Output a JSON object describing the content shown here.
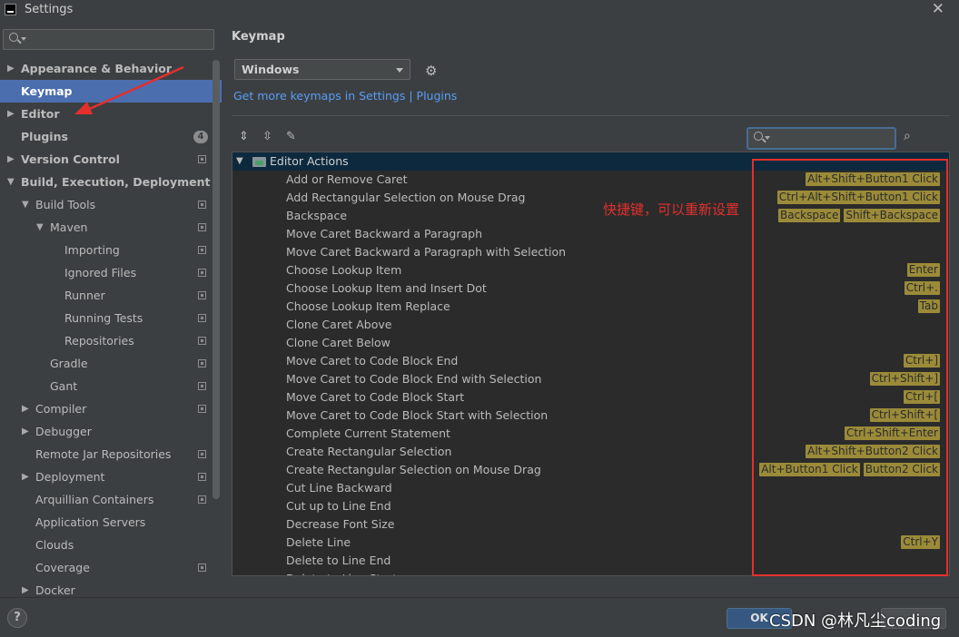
{
  "window": {
    "title": "Settings"
  },
  "sidebar": {
    "items": [
      {
        "label": "Appearance & Behavior",
        "level": 0,
        "arrow": "collapsed",
        "bold": true
      },
      {
        "label": "Keymap",
        "level": 0,
        "arrow": "none",
        "bold": true,
        "selected": true
      },
      {
        "label": "Editor",
        "level": 0,
        "arrow": "collapsed",
        "bold": true
      },
      {
        "label": "Plugins",
        "level": 0,
        "arrow": "none",
        "bold": true,
        "badge": "4"
      },
      {
        "label": "Version Control",
        "level": 0,
        "arrow": "collapsed",
        "bold": true,
        "project": true
      },
      {
        "label": "Build, Execution, Deployment",
        "level": 0,
        "arrow": "expanded",
        "bold": true
      },
      {
        "label": "Build Tools",
        "level": 1,
        "arrow": "expanded",
        "project": true
      },
      {
        "label": "Maven",
        "level": 2,
        "arrow": "expanded",
        "project": true
      },
      {
        "label": "Importing",
        "level": 3,
        "arrow": "none",
        "project": true
      },
      {
        "label": "Ignored Files",
        "level": 3,
        "arrow": "none",
        "project": true
      },
      {
        "label": "Runner",
        "level": 3,
        "arrow": "none",
        "project": true
      },
      {
        "label": "Running Tests",
        "level": 3,
        "arrow": "none",
        "project": true
      },
      {
        "label": "Repositories",
        "level": 3,
        "arrow": "none",
        "project": true
      },
      {
        "label": "Gradle",
        "level": 2,
        "arrow": "none",
        "project": true
      },
      {
        "label": "Gant",
        "level": 2,
        "arrow": "none",
        "project": true
      },
      {
        "label": "Compiler",
        "level": 1,
        "arrow": "collapsed",
        "project": true
      },
      {
        "label": "Debugger",
        "level": 1,
        "arrow": "collapsed"
      },
      {
        "label": "Remote Jar Repositories",
        "level": 1,
        "arrow": "none",
        "project": true
      },
      {
        "label": "Deployment",
        "level": 1,
        "arrow": "collapsed",
        "project": true
      },
      {
        "label": "Arquillian Containers",
        "level": 1,
        "arrow": "none",
        "project": true
      },
      {
        "label": "Application Servers",
        "level": 1,
        "arrow": "none"
      },
      {
        "label": "Clouds",
        "level": 1,
        "arrow": "none"
      },
      {
        "label": "Coverage",
        "level": 1,
        "arrow": "none",
        "project": true
      },
      {
        "label": "Docker",
        "level": 1,
        "arrow": "collapsed"
      }
    ]
  },
  "main": {
    "title": "Keymap",
    "keymap_select": "Windows",
    "link": "Get more keymaps in Settings | Plugins",
    "search": {
      "value": ""
    },
    "group_label": "Editor Actions",
    "annotation": "快捷键，可以重新设置",
    "actions": [
      {
        "name": "Add or Remove Caret",
        "keys": [
          "Alt+Shift+Button1 Click"
        ]
      },
      {
        "name": "Add Rectangular Selection on Mouse Drag",
        "keys": [
          "Ctrl+Alt+Shift+Button1 Click"
        ]
      },
      {
        "name": "Backspace",
        "keys": [
          "Backspace",
          "Shift+Backspace"
        ]
      },
      {
        "name": "Move Caret Backward a Paragraph",
        "keys": []
      },
      {
        "name": "Move Caret Backward a Paragraph with Selection",
        "keys": []
      },
      {
        "name": "Choose Lookup Item",
        "keys": [
          "Enter"
        ]
      },
      {
        "name": "Choose Lookup Item and Insert Dot",
        "keys": [
          "Ctrl+."
        ]
      },
      {
        "name": "Choose Lookup Item Replace",
        "keys": [
          "Tab"
        ]
      },
      {
        "name": "Clone Caret Above",
        "keys": []
      },
      {
        "name": "Clone Caret Below",
        "keys": []
      },
      {
        "name": "Move Caret to Code Block End",
        "keys": [
          "Ctrl+]"
        ]
      },
      {
        "name": "Move Caret to Code Block End with Selection",
        "keys": [
          "Ctrl+Shift+]"
        ]
      },
      {
        "name": "Move Caret to Code Block Start",
        "keys": [
          "Ctrl+["
        ]
      },
      {
        "name": "Move Caret to Code Block Start with Selection",
        "keys": [
          "Ctrl+Shift+["
        ]
      },
      {
        "name": "Complete Current Statement",
        "keys": [
          "Ctrl+Shift+Enter"
        ]
      },
      {
        "name": "Create Rectangular Selection",
        "keys": [
          "Alt+Shift+Button2 Click"
        ]
      },
      {
        "name": "Create Rectangular Selection on Mouse Drag",
        "keys": [
          "Alt+Button1 Click",
          "Button2 Click"
        ]
      },
      {
        "name": "Cut Line Backward",
        "keys": []
      },
      {
        "name": "Cut up to Line End",
        "keys": []
      },
      {
        "name": "Decrease Font Size",
        "keys": []
      },
      {
        "name": "Delete Line",
        "keys": [
          "Ctrl+Y"
        ]
      },
      {
        "name": "Delete to Line End",
        "keys": []
      },
      {
        "name": "Delete to Line Start",
        "keys": []
      }
    ]
  },
  "footer": {
    "help_label": "?",
    "ok_label": "OK",
    "watermark": "CSDN @林凡尘coding"
  },
  "colors": {
    "accent": "#4b6eaf",
    "shortcut_bg": "#9b8b39",
    "annotation": "#e3302d",
    "link": "#589df6"
  }
}
